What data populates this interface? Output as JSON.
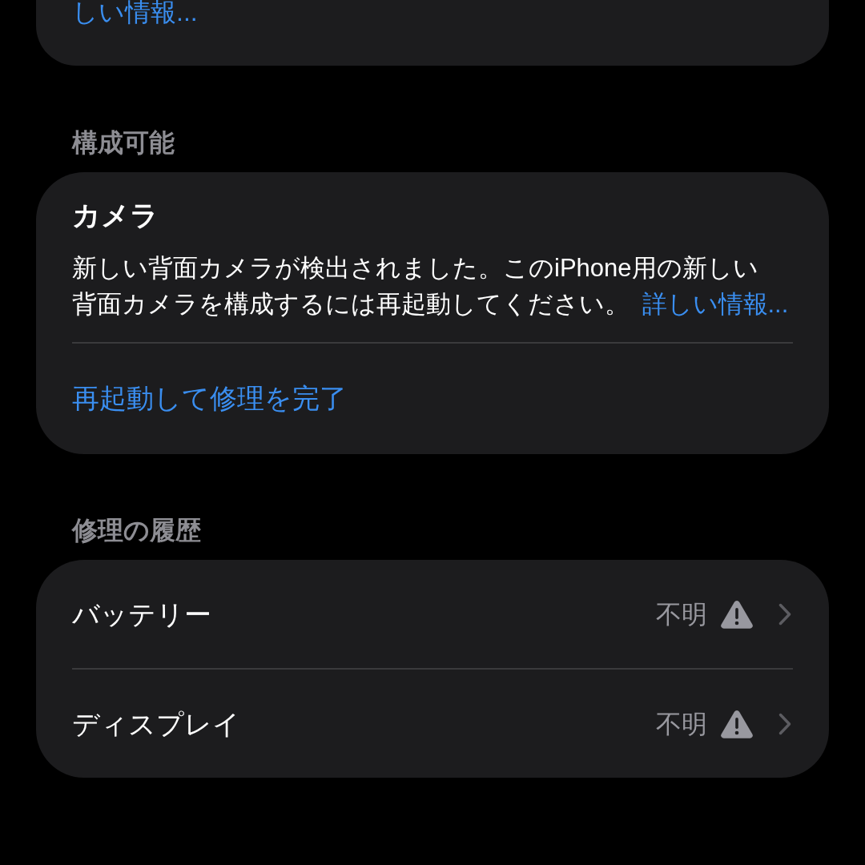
{
  "top_card": {
    "link": "しい情報..."
  },
  "sections": [
    {
      "header": "構成可能",
      "card": {
        "kind": "notice",
        "title": "カメラ",
        "body": "新しい背面カメラが検出されました。このiPhone用の新しい背面カメラを構成するには再起動してください。",
        "link": "詳しい情報...",
        "action": "再起動して修理を完了"
      }
    },
    {
      "header": "修理の履歴",
      "card": {
        "kind": "list",
        "rows": [
          {
            "label": "バッテリー",
            "value": "不明"
          },
          {
            "label": "ディスプレイ",
            "value": "不明"
          }
        ]
      }
    }
  ]
}
